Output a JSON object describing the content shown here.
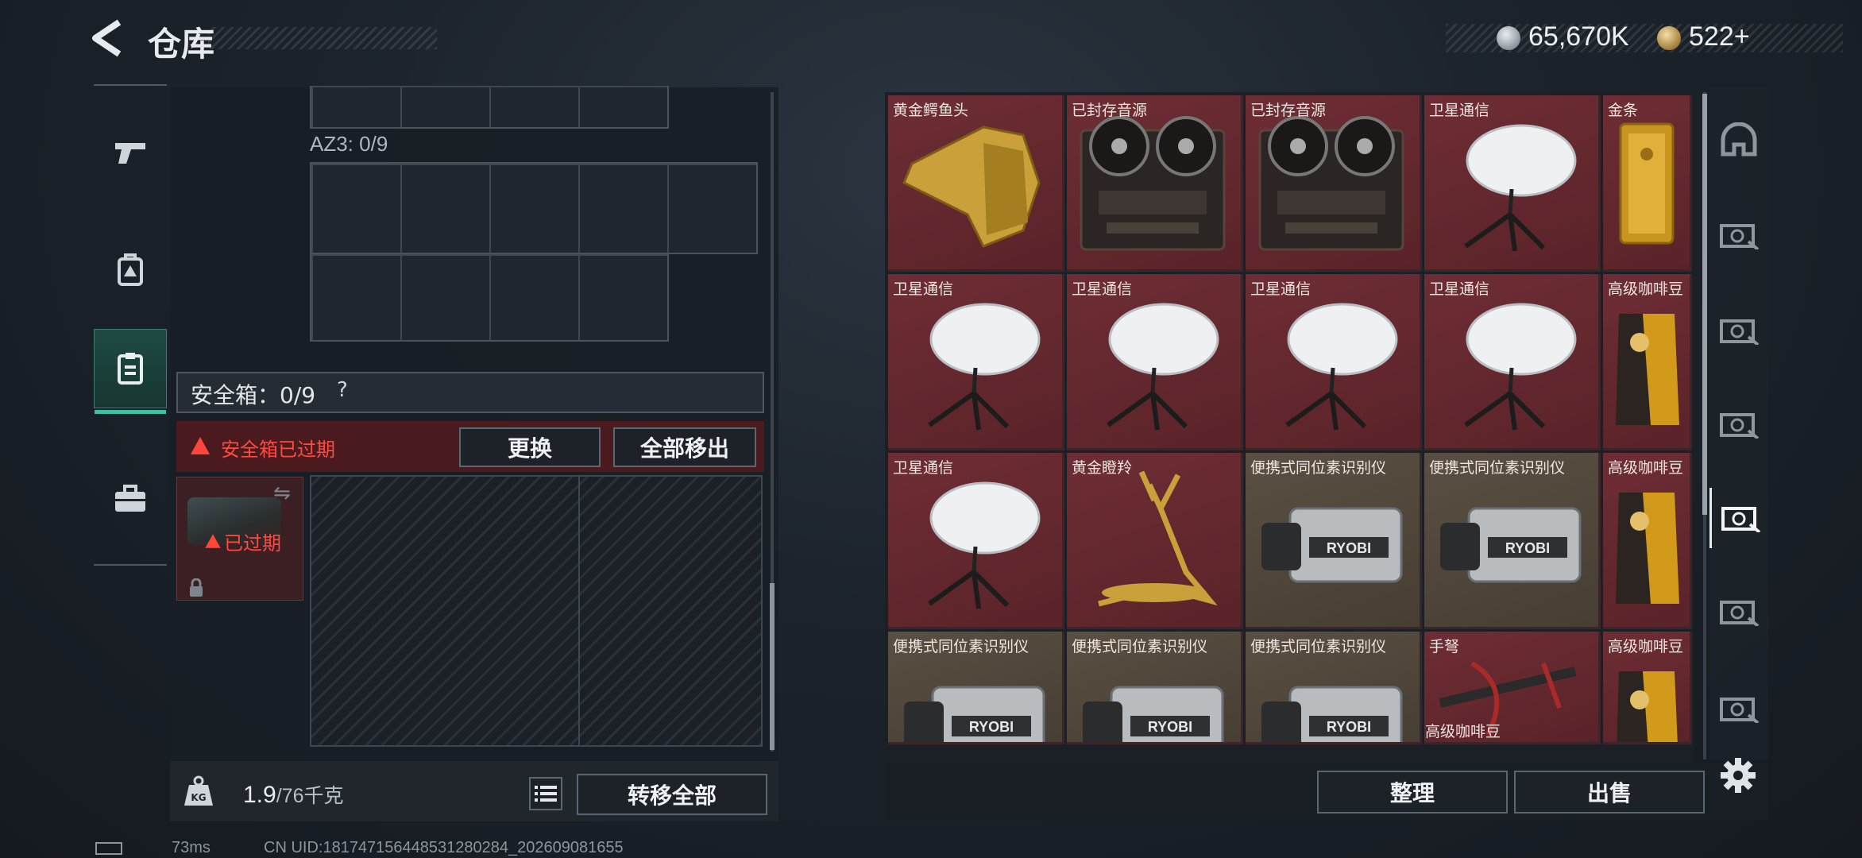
{
  "header": {
    "title": "仓库",
    "currency": [
      {
        "icon": "silver-coin-icon",
        "amount": "65,670K"
      },
      {
        "icon": "gold-coin-icon",
        "amount": "522+"
      }
    ]
  },
  "left_sidebar": {
    "items": [
      {
        "icon": "pistol-icon",
        "active": false
      },
      {
        "icon": "backpack-icon",
        "active": false
      },
      {
        "icon": "safe-box-icon",
        "active": true
      },
      {
        "icon": "briefcase-icon",
        "active": false
      }
    ]
  },
  "storage": {
    "az3_label": "AZ3: 0/9",
    "safe_box_label": "安全箱：0/9",
    "safe_box_help": "?",
    "expired_message": "安全箱已过期",
    "replace_button": "更换",
    "remove_all_button": "全部移出",
    "slot_status": "已过期",
    "weight_current": "1.9",
    "weight_max": "/76千克",
    "transfer_all_button": "转移全部"
  },
  "items": [
    {
      "name": "黄金鳄鱼头",
      "rarity": "red",
      "icon": "golden-crocodile-head-icon"
    },
    {
      "name": "已封存音源",
      "rarity": "red",
      "icon": "reel-tape-recorder-icon"
    },
    {
      "name": "已封存音源",
      "rarity": "red",
      "icon": "reel-tape-recorder-icon"
    },
    {
      "name": "卫星通信",
      "rarity": "red",
      "icon": "satellite-dish-icon"
    },
    {
      "name": "金条",
      "rarity": "red",
      "icon": "gold-bar-icon"
    },
    {
      "name": "卫星通信",
      "rarity": "red",
      "icon": "satellite-dish-icon"
    },
    {
      "name": "卫星通信",
      "rarity": "red",
      "icon": "satellite-dish-icon"
    },
    {
      "name": "卫星通信",
      "rarity": "red",
      "icon": "satellite-dish-icon"
    },
    {
      "name": "卫星通信",
      "rarity": "red",
      "icon": "satellite-dish-icon"
    },
    {
      "name": "高级咖啡豆",
      "rarity": "red",
      "icon": "coffee-bag-icon"
    },
    {
      "name": "卫星通信",
      "rarity": "red",
      "icon": "satellite-dish-icon"
    },
    {
      "name": "黄金瞪羚",
      "rarity": "red",
      "icon": "golden-gazelle-icon"
    },
    {
      "name": "便携式同位素识别仪",
      "rarity": "brown",
      "icon": "isotope-identifier-icon"
    },
    {
      "name": "便携式同位素识别仪",
      "rarity": "brown",
      "icon": "isotope-identifier-icon"
    },
    {
      "name": "高级咖啡豆",
      "rarity": "red",
      "icon": "coffee-bag-icon"
    },
    {
      "name": "便携式同位素识别仪",
      "rarity": "brown",
      "icon": "isotope-identifier-icon"
    },
    {
      "name": "便携式同位素识别仪",
      "rarity": "brown",
      "icon": "isotope-identifier-icon"
    },
    {
      "name": "便携式同位素识别仪",
      "rarity": "brown",
      "icon": "isotope-identifier-icon"
    },
    {
      "name": "手弩",
      "rarity": "red",
      "icon": "hand-crossbow-icon"
    },
    {
      "name": "高级咖啡豆",
      "rarity": "red",
      "icon": "coffee-bag-icon"
    }
  ],
  "extra_item_label": "高级咖啡豆",
  "items_panel": {
    "sort_button": "整理",
    "sell_button": "出售"
  },
  "right_sidebar": {
    "items": [
      "helmet-icon",
      "rig-g-card-icon",
      "rig-iv-card-icon",
      "rig-v-card-icon",
      "rig-v-card-icon",
      "rig-v-card-icon",
      "rig-g-card-icon"
    ],
    "active_index": 4
  },
  "status": {
    "ping": "73ms",
    "uid": "CN UID:181747156448531280284_202609081655"
  },
  "colors": {
    "rarity_red": "#6e2d34",
    "rarity_brown": "#5a4f42",
    "accent_teal": "#3fbfa2",
    "alert_red": "#ff4a40"
  }
}
